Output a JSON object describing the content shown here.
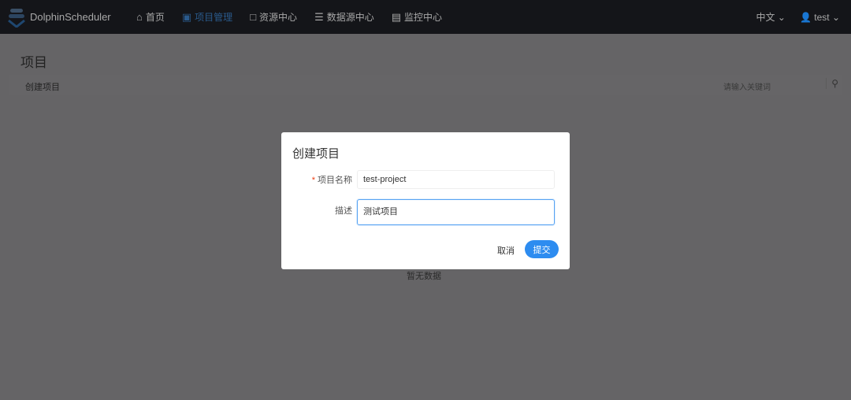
{
  "header": {
    "logo": "DolphinScheduler",
    "nav": [
      {
        "icon": "home-icon",
        "label": "首页"
      },
      {
        "icon": "project-icon",
        "label": "项目管理",
        "active": true
      },
      {
        "icon": "folder-icon",
        "label": "资源中心"
      },
      {
        "icon": "database-icon",
        "label": "数据源中心"
      },
      {
        "icon": "monitor-icon",
        "label": "监控中心"
      }
    ],
    "language": "中文",
    "user": "test"
  },
  "page": {
    "title": "项目",
    "create_button": "创建项目",
    "search_placeholder": "请输入关键词",
    "empty": "暂无数据"
  },
  "modal": {
    "title": "创建项目",
    "name_label": "项目名称",
    "name_value": "test-project",
    "desc_label": "描述",
    "desc_value": "测试项目",
    "cancel": "取消",
    "submit": "提交"
  }
}
